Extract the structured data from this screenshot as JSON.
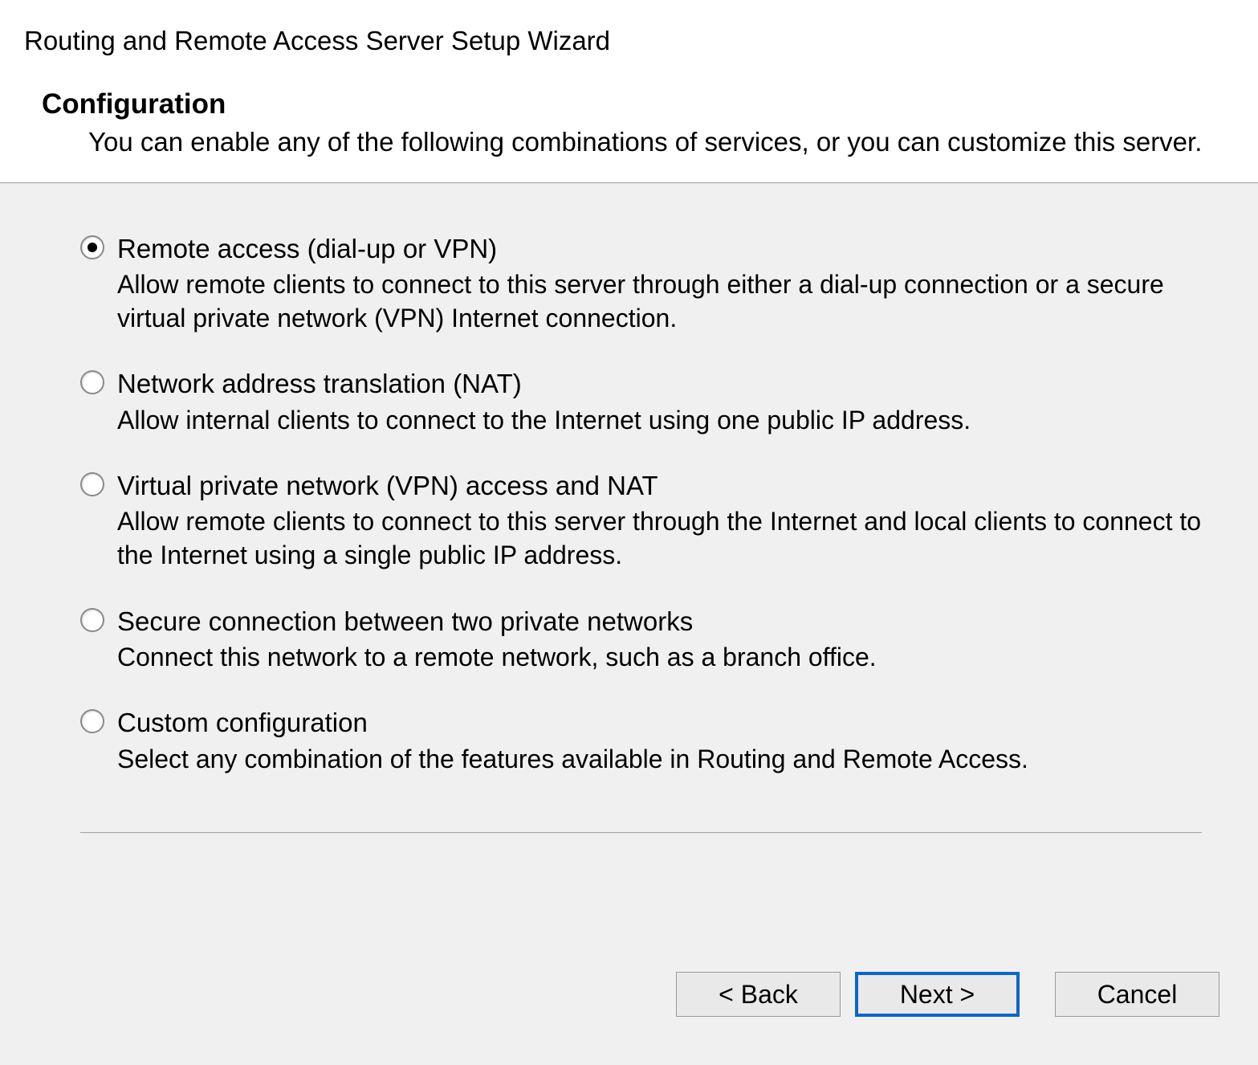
{
  "wizard": {
    "title": "Routing and Remote Access Server Setup Wizard",
    "page_heading": "Configuration",
    "page_description": "You can enable any of the following combinations of services, or you can customize this server."
  },
  "options": [
    {
      "id": "remote-access",
      "label": "Remote access (dial-up or VPN)",
      "description": "Allow remote clients to connect to this server through either a dial-up connection or a secure virtual private network (VPN) Internet connection.",
      "selected": true
    },
    {
      "id": "nat",
      "label": "Network address translation (NAT)",
      "description": "Allow internal clients to connect to the Internet using one public IP address.",
      "selected": false
    },
    {
      "id": "vpn-nat",
      "label": "Virtual private network (VPN) access and NAT",
      "description": "Allow remote clients to connect to this server through the Internet and local clients to connect to the Internet using a single public IP address.",
      "selected": false
    },
    {
      "id": "secure-connection",
      "label": "Secure connection between two private networks",
      "description": "Connect this network to a remote network, such as a branch office.",
      "selected": false
    },
    {
      "id": "custom",
      "label": "Custom configuration",
      "description": "Select any combination of the features available in Routing and Remote Access.",
      "selected": false
    }
  ],
  "buttons": {
    "back": "< Back",
    "next": "Next >",
    "cancel": "Cancel"
  }
}
